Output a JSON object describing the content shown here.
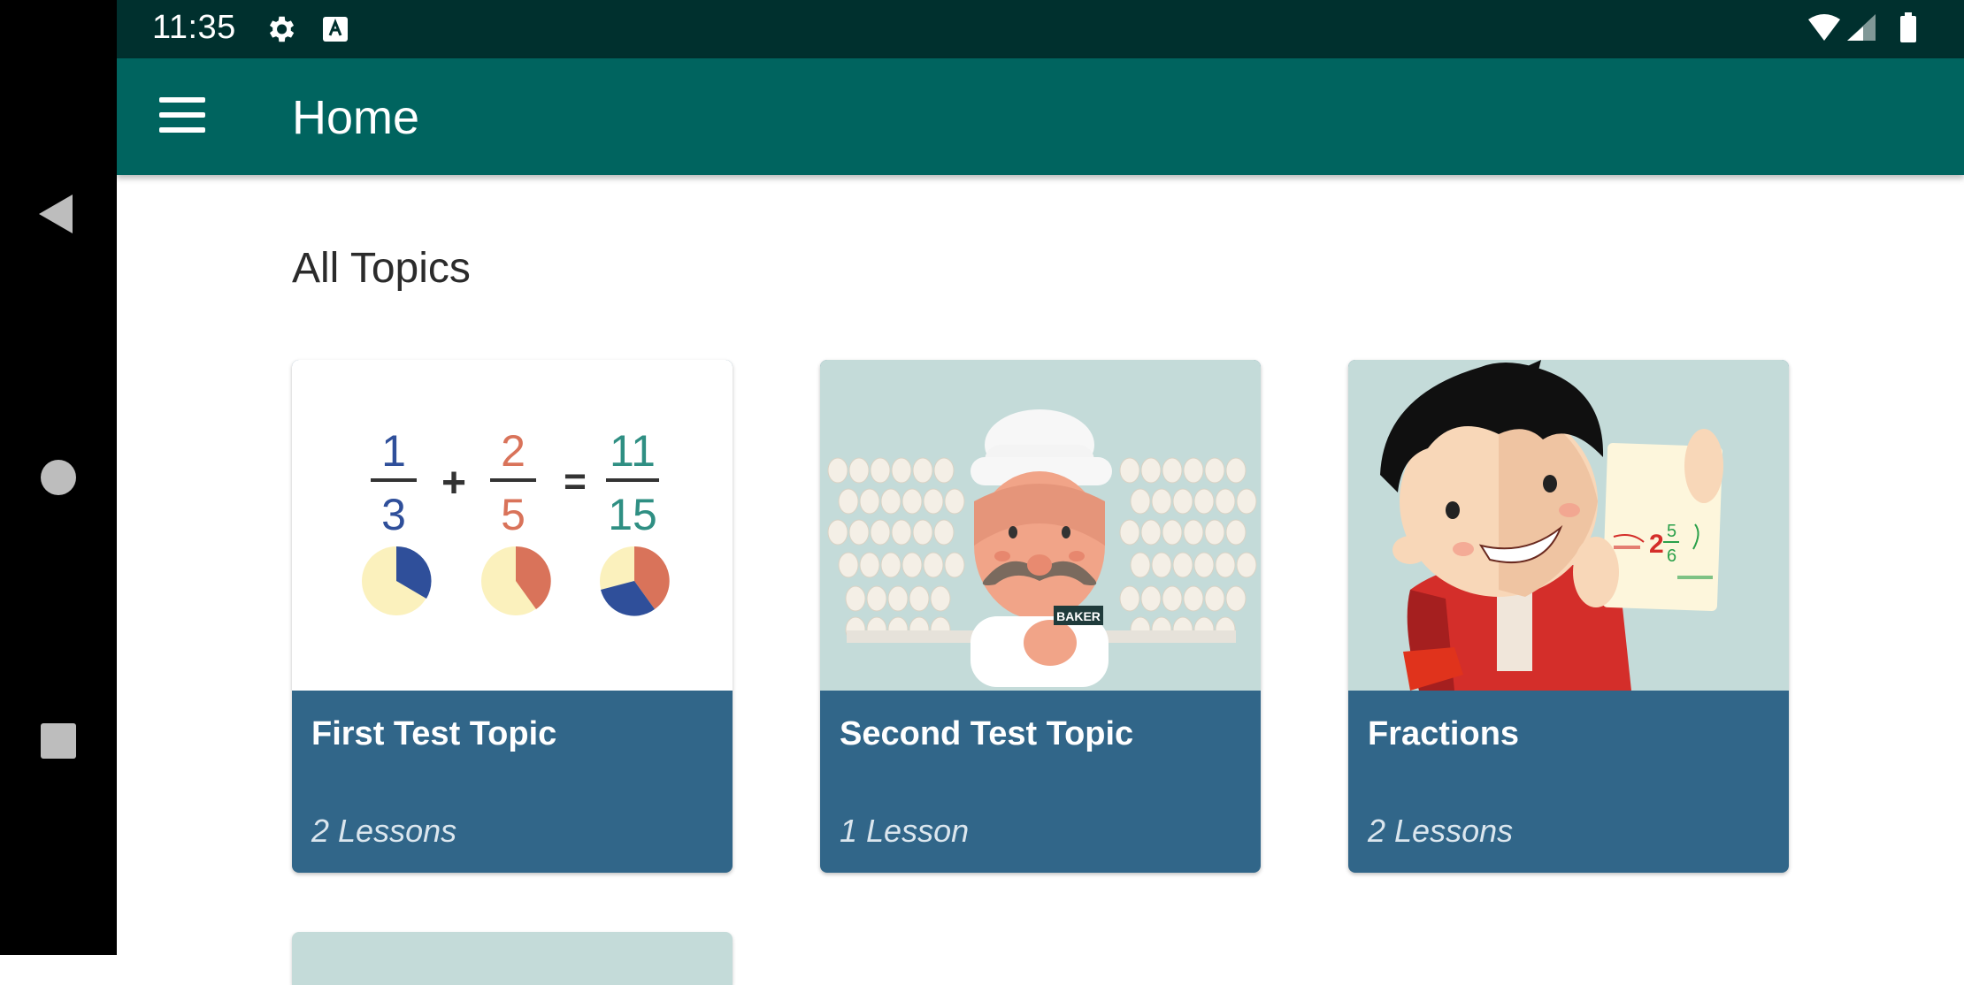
{
  "status_bar": {
    "time": "11:35",
    "icons": [
      "gear-icon",
      "keyboard-a-icon",
      "wifi-icon",
      "cellular-signal-icon",
      "battery-icon"
    ]
  },
  "app_bar": {
    "title": "Home",
    "menu_icon": "hamburger-menu-icon"
  },
  "main": {
    "section_title": "All Topics",
    "topics": [
      {
        "title": "First Test Topic",
        "lessons": "2 Lessons",
        "illustration": {
          "fractions": [
            {
              "numerator": "1",
              "denominator": "3"
            },
            {
              "numerator": "2",
              "denominator": "5"
            },
            {
              "numerator": "11",
              "denominator": "15"
            }
          ],
          "plus": "+",
          "equals": "="
        }
      },
      {
        "title": "Second Test Topic",
        "lessons": "1 Lesson",
        "illustration": {
          "badge": "BAKER"
        }
      },
      {
        "title": "Fractions",
        "lessons": "2 Lessons",
        "illustration": {
          "paper_number": "2",
          "paper_numerator": "5",
          "paper_denominator": "6"
        }
      }
    ]
  },
  "nav_bar": {
    "icons": [
      "back-icon",
      "home-icon",
      "recents-icon"
    ]
  },
  "colors": {
    "status_bar": "#00302e",
    "app_bar": "#00645f",
    "card_footer": "#316689",
    "card_image_bg": "#c4dbd9",
    "fraction_blue": "#2f4f9a",
    "fraction_orange": "#d9735a",
    "fraction_teal": "#2f8f83"
  }
}
